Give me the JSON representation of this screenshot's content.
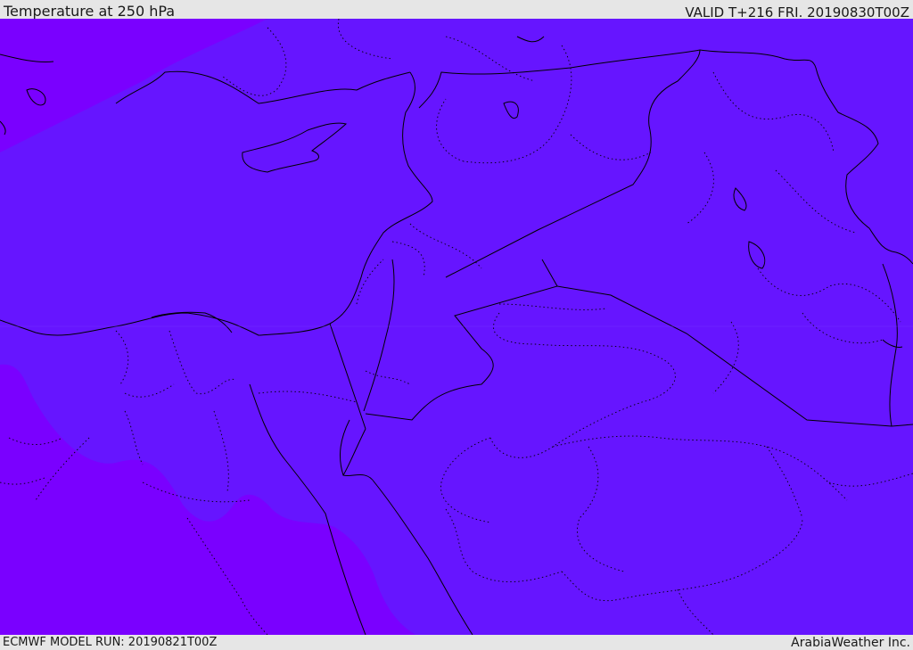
{
  "header": {
    "title": "Temperature at 250 hPa",
    "valid": "VALID T+216 FRI. 20190830T00Z"
  },
  "footer": {
    "model_run": "ECMWF MODEL RUN: 20190821T00Z",
    "provider": "ArabiaWeather Inc."
  },
  "map": {
    "colors": {
      "main_fill": "#6615ff",
      "warm_fill": "#7a00ff",
      "coastline": "#000000",
      "border": "#000000"
    },
    "icons": {
      "coastline": "solid-line",
      "international_border": "solid-line",
      "province_border": "dotted-line"
    }
  }
}
